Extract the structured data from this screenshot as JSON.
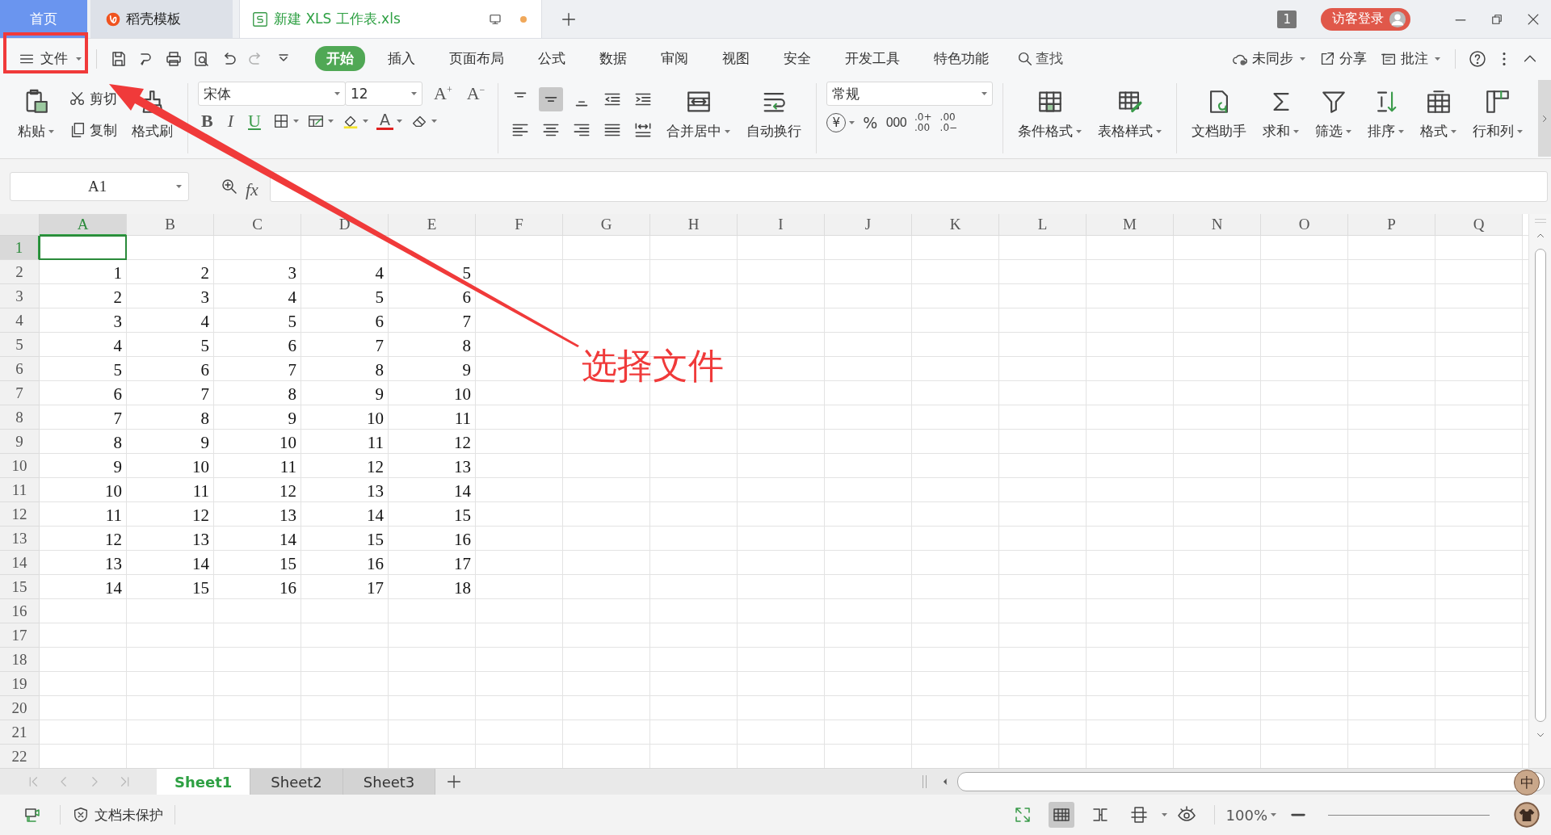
{
  "tabs": [
    {
      "label": "首页",
      "kind": "home",
      "selected": false
    },
    {
      "label": "稻壳模板",
      "kind": "docer",
      "selected": false
    },
    {
      "label": "新建 XLS 工作表.xls",
      "kind": "sheet",
      "selected": true,
      "unsaved": true
    }
  ],
  "title_bar": {
    "window_count": "1",
    "login_button": "访客登录"
  },
  "menu": {
    "file_button": "文件",
    "items": [
      {
        "label": "开始",
        "selected": true
      },
      {
        "label": "插入",
        "selected": false
      },
      {
        "label": "页面布局",
        "selected": false
      },
      {
        "label": "公式",
        "selected": false
      },
      {
        "label": "数据",
        "selected": false
      },
      {
        "label": "审阅",
        "selected": false
      },
      {
        "label": "视图",
        "selected": false
      },
      {
        "label": "安全",
        "selected": false
      },
      {
        "label": "开发工具",
        "selected": false
      },
      {
        "label": "特色功能",
        "selected": false
      }
    ],
    "search": "查找",
    "right_items": [
      {
        "label": "未同步",
        "dropdown": true
      },
      {
        "label": "分享",
        "dropdown": false
      },
      {
        "label": "批注",
        "dropdown": true
      }
    ]
  },
  "ribbon": {
    "clipboard": {
      "paste": "粘贴",
      "cut": "剪切",
      "copy": "复制",
      "format_painter": "格式刷"
    },
    "font": {
      "name": "宋体",
      "size": "12",
      "grow": "A$^{+}$",
      "shrink": "A$^{−}$",
      "bold": "B",
      "italic": "I",
      "underline": "U",
      "font_color": "A"
    },
    "align_buttons": [
      {
        "selected": false
      },
      {
        "selected": true
      },
      {
        "selected": false
      },
      {
        "selected": false
      },
      {
        "selected": false
      },
      {
        "selected": false
      },
      {
        "selected": false
      },
      {
        "selected": false
      },
      {
        "selected": false
      },
      {
        "selected": false
      }
    ],
    "alignment": [
      {
        "label": "合并居中",
        "dropdown": true
      },
      {
        "label": "自动换行",
        "dropdown": false
      }
    ],
    "number": {
      "format": "常规",
      "currency": "¥",
      "percent": "%",
      "thousands": "000",
      "decimals": [
        [
          ".0+",
          ".00"
        ],
        [
          ".00",
          ".0−"
        ]
      ]
    },
    "styles": [
      {
        "label": "条件格式",
        "dropdown": true
      },
      {
        "label": "表格样式",
        "dropdown": true
      }
    ],
    "tools": [
      {
        "label": "文档助手",
        "dropdown": false
      },
      {
        "label": "求和",
        "dropdown": true
      },
      {
        "label": "筛选",
        "dropdown": true
      },
      {
        "label": "排序",
        "dropdown": true
      },
      {
        "label": "格式",
        "dropdown": true
      },
      {
        "label": "行和列",
        "dropdown": true
      }
    ]
  },
  "formula_bar": {
    "name_box": "A1",
    "function_label": "fx"
  },
  "grid": {
    "columns": [
      {
        "label": "A",
        "selected": true
      },
      {
        "label": "B",
        "selected": false
      },
      {
        "label": "C",
        "selected": false
      },
      {
        "label": "D",
        "selected": false
      },
      {
        "label": "E",
        "selected": false
      },
      {
        "label": "F",
        "selected": false
      },
      {
        "label": "G",
        "selected": false
      },
      {
        "label": "H",
        "selected": false
      },
      {
        "label": "I",
        "selected": false
      },
      {
        "label": "J",
        "selected": false
      },
      {
        "label": "K",
        "selected": false
      },
      {
        "label": "L",
        "selected": false
      },
      {
        "label": "M",
        "selected": false
      },
      {
        "label": "N",
        "selected": false
      },
      {
        "label": "O",
        "selected": false
      },
      {
        "label": "P",
        "selected": false
      },
      {
        "label": "Q",
        "selected": false
      }
    ],
    "rows": [
      {
        "header": "1",
        "selected": true
      },
      {
        "header": "2",
        "selected": false,
        "cells": [
          "1",
          "2",
          "3",
          "4",
          "5"
        ]
      },
      {
        "header": "3",
        "selected": false,
        "cells": [
          "2",
          "3",
          "4",
          "5",
          "6"
        ]
      },
      {
        "header": "4",
        "selected": false,
        "cells": [
          "3",
          "4",
          "5",
          "6",
          "7"
        ]
      },
      {
        "header": "5",
        "selected": false,
        "cells": [
          "4",
          "5",
          "6",
          "7",
          "8"
        ]
      },
      {
        "header": "6",
        "selected": false,
        "cells": [
          "5",
          "6",
          "7",
          "8",
          "9"
        ]
      },
      {
        "header": "7",
        "selected": false,
        "cells": [
          "6",
          "7",
          "8",
          "9",
          "10"
        ]
      },
      {
        "header": "8",
        "selected": false,
        "cells": [
          "7",
          "8",
          "9",
          "10",
          "11"
        ]
      },
      {
        "header": "9",
        "selected": false,
        "cells": [
          "8",
          "9",
          "10",
          "11",
          "12"
        ]
      },
      {
        "header": "10",
        "selected": false,
        "cells": [
          "9",
          "10",
          "11",
          "12",
          "13"
        ]
      },
      {
        "header": "11",
        "selected": false,
        "cells": [
          "10",
          "11",
          "12",
          "13",
          "14"
        ]
      },
      {
        "header": "12",
        "selected": false,
        "cells": [
          "11",
          "12",
          "13",
          "14",
          "15"
        ]
      },
      {
        "header": "13",
        "selected": false,
        "cells": [
          "12",
          "13",
          "14",
          "15",
          "16"
        ]
      },
      {
        "header": "14",
        "selected": false,
        "cells": [
          "13",
          "14",
          "15",
          "16",
          "17"
        ]
      },
      {
        "header": "15",
        "selected": false,
        "cells": [
          "14",
          "15",
          "16",
          "17",
          "18"
        ]
      },
      {
        "header": "16",
        "selected": false
      },
      {
        "header": "17",
        "selected": false
      },
      {
        "header": "18",
        "selected": false
      },
      {
        "header": "19",
        "selected": false
      },
      {
        "header": "20",
        "selected": false
      },
      {
        "header": "21",
        "selected": false
      },
      {
        "header": "22",
        "selected": false
      }
    ]
  },
  "sheet_tabs": [
    {
      "label": "Sheet1",
      "selected": true
    },
    {
      "label": "Sheet2",
      "selected": false
    },
    {
      "label": "Sheet3",
      "selected": false
    }
  ],
  "status_bar": {
    "protection": "文档未保护",
    "zoom": "100%",
    "ime": "中"
  },
  "annotation": {
    "label": "选择文件"
  }
}
